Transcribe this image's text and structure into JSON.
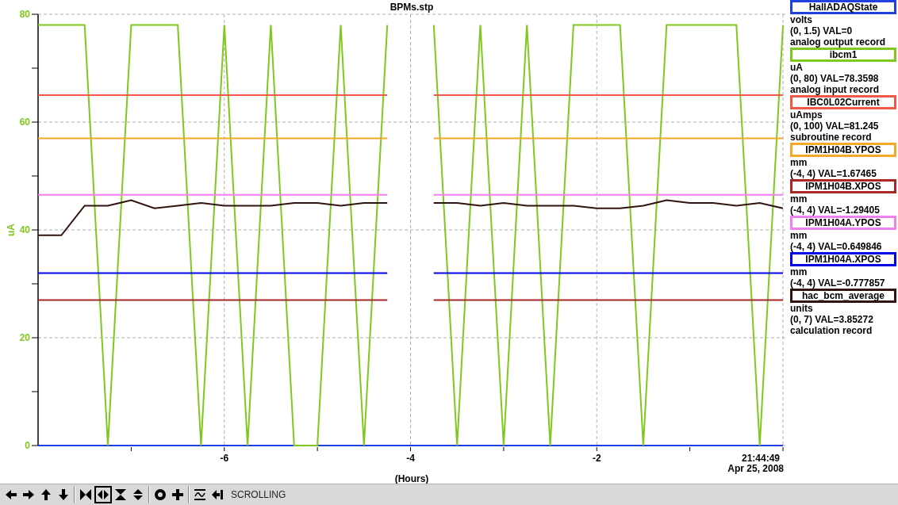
{
  "plot": {
    "time_label": "21:44:49",
    "date_label": "Apr 25, 2008",
    "chart_data": {
      "type": "line",
      "title": "BPMs.stp",
      "xlabel": "(Hours)",
      "ylabel": "uA",
      "grid": true,
      "x": [
        -8,
        -7.75,
        -7.5,
        -7.25,
        -7,
        -6.75,
        -6.5,
        -6.25,
        -6,
        -5.75,
        -5.5,
        -5.25,
        -5,
        -4.75,
        -4.5,
        -4.25,
        -4,
        -3.75,
        -3.5,
        -3.25,
        -3,
        -2.75,
        -2.5,
        -2.25,
        -2,
        -1.75,
        -1.5,
        -1.25,
        -1,
        -0.75,
        -0.5,
        -0.25,
        0
      ],
      "xlim": [
        -8,
        0
      ],
      "ylim": [
        0,
        80
      ],
      "xticks": [
        -6,
        -4,
        -2
      ],
      "yticks": [
        0,
        20,
        40,
        60,
        80
      ],
      "series": [
        {
          "name": "HallADAQState",
          "color": "#2040e0",
          "values": [
            0,
            0,
            0,
            0,
            0,
            0,
            0,
            0,
            0,
            0,
            0,
            0,
            0,
            0,
            0,
            0,
            0,
            0,
            0,
            0,
            0,
            0,
            0,
            0,
            0,
            0,
            0,
            0,
            0,
            0,
            0,
            0,
            0
          ]
        },
        {
          "name": "ibcm1",
          "color": "#80c820",
          "values": [
            78,
            78,
            78,
            0,
            78,
            78,
            78,
            0,
            78,
            0,
            78,
            0,
            0,
            78,
            0,
            78,
            null,
            78,
            0,
            78,
            0,
            78,
            0,
            78,
            78,
            78,
            0,
            78,
            78,
            78,
            78,
            0,
            78
          ]
        },
        {
          "name": "IBC0L02Current",
          "color": "#f05848",
          "values": [
            65,
            65,
            65,
            65,
            65,
            65,
            65,
            65,
            65,
            65,
            65,
            65,
            65,
            65,
            65,
            65,
            null,
            65,
            65,
            65,
            65,
            65,
            65,
            65,
            65,
            65,
            65,
            65,
            65,
            65,
            65,
            65,
            65
          ]
        },
        {
          "name": "IPM1H04B.YPOS",
          "color": "#f8a828",
          "values": [
            57,
            57,
            57,
            57,
            57,
            57,
            57,
            57,
            57,
            57,
            57,
            57,
            57,
            57,
            57,
            57,
            null,
            57,
            57,
            57,
            57,
            57,
            57,
            57,
            57,
            57,
            57,
            57,
            57,
            57,
            57,
            57,
            57
          ]
        },
        {
          "name": "IPM1H04B.XPOS",
          "color": "#a82828",
          "values": [
            27,
            27,
            27,
            27,
            27,
            27,
            27,
            27,
            27,
            27,
            27,
            27,
            27,
            27,
            27,
            27,
            null,
            27,
            27,
            27,
            27,
            27,
            27,
            27,
            27,
            27,
            27,
            27,
            27,
            27,
            27,
            27,
            27
          ]
        },
        {
          "name": "IPM1H04A.YPOS",
          "color": "#f080f0",
          "values": [
            46.5,
            46.5,
            46.5,
            46.5,
            46.5,
            46.5,
            46.5,
            46.5,
            46.5,
            46.5,
            46.5,
            46.5,
            46.5,
            46.5,
            46.5,
            46.5,
            null,
            46.5,
            46.5,
            46.5,
            46.5,
            46.5,
            46.5,
            46.5,
            46.5,
            46.5,
            46.5,
            46.5,
            46.5,
            46.5,
            46.5,
            46.5,
            46.5
          ]
        },
        {
          "name": "IPM1H04A.XPOS",
          "color": "#0000e8",
          "values": [
            32,
            32,
            32,
            32,
            32,
            32,
            32,
            32,
            32,
            32,
            32,
            32,
            32,
            32,
            32,
            32,
            null,
            32,
            32,
            32,
            32,
            32,
            32,
            32,
            32,
            32,
            32,
            32,
            32,
            32,
            32,
            32,
            32
          ]
        },
        {
          "name": "hac_bcm_average",
          "color": "#301410",
          "values": [
            39,
            39,
            44.5,
            44.5,
            45.5,
            44,
            44.5,
            45,
            44.5,
            44.5,
            44.5,
            45,
            45,
            44.5,
            45,
            45,
            null,
            45,
            45,
            44.5,
            45,
            44.5,
            44.5,
            44.5,
            44,
            44,
            44.5,
            45.5,
            45,
            45,
            44.5,
            45,
            44
          ]
        }
      ]
    }
  },
  "legend": [
    {
      "units": "volts",
      "reading": "(0, 1.5) VAL=0",
      "record": "analog output record"
    },
    {
      "units": "uA",
      "reading": "(0, 80) VAL=78.3598",
      "record": "analog input record"
    },
    {
      "units": "uAmps",
      "reading": "(0, 100) VAL=81.245",
      "record": "subroutine record"
    },
    {
      "units": "mm",
      "reading": "(-4, 4) VAL=1.67465"
    },
    {
      "units": "mm",
      "reading": "(-4, 4) VAL=-1.29405"
    },
    {
      "units": "mm",
      "reading": "(-4, 4) VAL=0.649846"
    },
    {
      "units": "mm",
      "reading": "(-4, 4) VAL=-0.777857"
    },
    {
      "units": "units",
      "reading": "(0, 7) VAL=3.85272",
      "record": "calculation record"
    }
  ],
  "toolbar": {
    "buttons": [
      {
        "kind": "pan-left",
        "selected": false
      },
      {
        "kind": "pan-right",
        "selected": false
      },
      {
        "kind": "pan-up",
        "selected": false
      },
      {
        "kind": "pan-down",
        "selected": false
      },
      {
        "kind": "zoom-in-x",
        "selected": false
      },
      {
        "kind": "zoom-out-x",
        "selected": true
      },
      {
        "kind": "zoom-in-y",
        "selected": false
      },
      {
        "kind": "zoom-out-y",
        "selected": false
      },
      {
        "kind": "auto-scale",
        "selected": false
      },
      {
        "kind": "reset",
        "selected": false
      },
      {
        "kind": "graph",
        "selected": false
      },
      {
        "kind": "jump-end",
        "selected": false
      }
    ],
    "mode": "SCROLLING"
  }
}
